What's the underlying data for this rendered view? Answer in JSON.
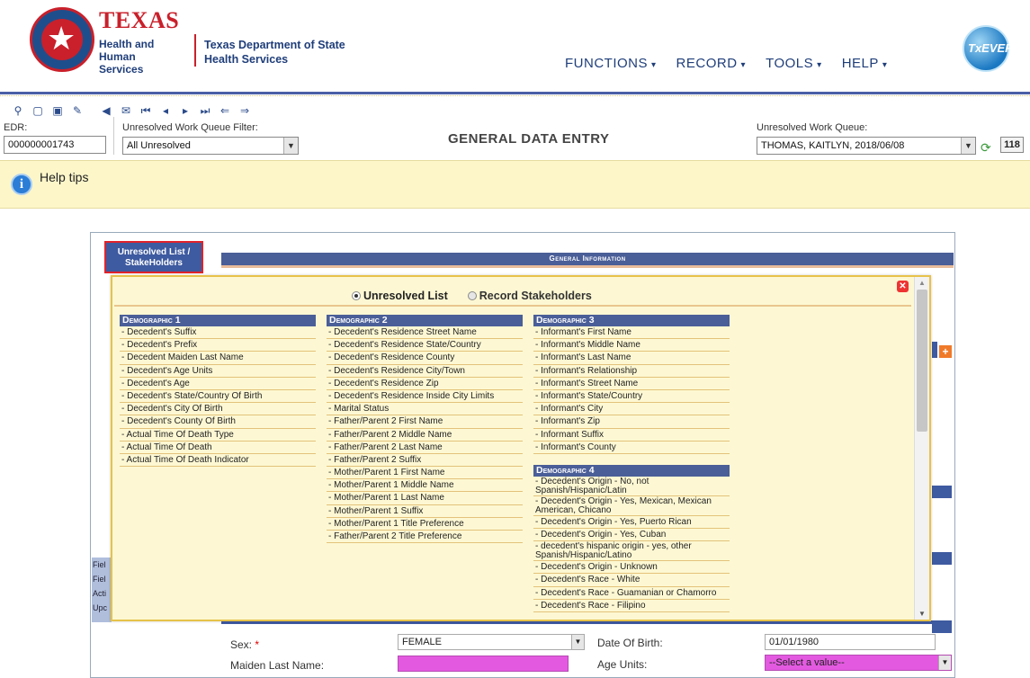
{
  "header": {
    "texas": "TEXAS",
    "hhs_line1": "Health and Human",
    "hhs_line2": "Services",
    "dshs_line1": "Texas Department of State",
    "dshs_line2": "Health Services",
    "nav": [
      "FUNCTIONS",
      "RECORD",
      "TOOLS",
      "HELP"
    ],
    "txever": "TxEVER"
  },
  "toolbar": {
    "edr_label": "EDR:",
    "edr_value": "000000001743",
    "filter_label": "Unresolved Work Queue Filter:",
    "filter_value": "All Unresolved",
    "page_title": "GENERAL DATA ENTRY",
    "queue_label": "Unresolved Work Queue:",
    "queue_value": "THOMAS, KAITLYN, 2018/06/08",
    "queue_count": "118"
  },
  "help": {
    "text": "Help tips"
  },
  "form": {
    "tab_label": "Unresolved List / StakeHolders",
    "section_title": "General Information",
    "left_strip": [
      "Fiel",
      "Fiel",
      "Acti",
      "Upc"
    ],
    "sex_label": "Sex:",
    "sex_value": "FEMALE",
    "maiden_label": "Maiden Last Name:",
    "dob_label": "Date Of Birth:",
    "dob_value": "01/01/1980",
    "age_units_label": "Age Units:",
    "age_units_value": "--Select a value--"
  },
  "popup": {
    "radio_unresolved": "Unresolved List",
    "radio_stakeholders": "Record Stakeholders",
    "demographic1": {
      "title": "Demographic 1",
      "items": [
        "- Decedent's Suffix",
        "- Decedent's Prefix",
        "- Decedent Maiden Last Name",
        "- Decedent's Age Units",
        "- Decedent's Age",
        "- Decedent's State/Country Of Birth",
        "- Decedent's City Of Birth",
        "- Decedent's County Of Birth",
        "- Actual Time Of Death Type",
        "- Actual Time Of Death",
        "- Actual Time Of Death Indicator"
      ]
    },
    "demographic2": {
      "title": "Demographic 2",
      "items": [
        "- Decedent's Residence Street Name",
        "- Decedent's Residence State/Country",
        "- Decedent's Residence County",
        "- Decedent's Residence City/Town",
        "- Decedent's Residence Zip",
        "- Decedent's Residence Inside City Limits",
        "- Marital Status",
        "- Father/Parent 2 First Name",
        "- Father/Parent 2 Middle Name",
        "- Father/Parent 2 Last Name",
        "- Father/Parent 2 Suffix",
        "- Mother/Parent 1 First Name",
        "- Mother/Parent 1 Middle Name",
        "- Mother/Parent 1 Last Name",
        "- Mother/Parent 1 Suffix",
        "- Mother/Parent 1 Title Preference",
        "- Father/Parent 2 Title Preference"
      ]
    },
    "demographic3": {
      "title": "Demographic 3",
      "items": [
        "- Informant's First Name",
        "- Informant's Middle Name",
        "- Informant's Last Name",
        "- Informant's Relationship",
        "- Informant's Street Name",
        "- Informant's State/Country",
        "- Informant's City",
        "- Informant's Zip",
        "- Informant Suffix",
        "- Informant's County"
      ]
    },
    "demographic4": {
      "title": "Demographic 4",
      "items": [
        "- Decedent's Origin - No, not Spanish/Hispanic/Latin",
        "- Decedent's Origin - Yes, Mexican, Mexican American, Chicano",
        "- Decedent's Origin - Yes, Puerto Rican",
        "- Decedent's Origin - Yes, Cuban",
        "- decedent's hispanic origin - yes, other Spanish/Hispanic/Latino",
        "- Decedent's Origin - Unknown",
        "- Decedent's Race - White",
        "- Decedent's Race - Guamanian or Chamorro",
        "- Decedent's Race - Filipino"
      ]
    }
  }
}
